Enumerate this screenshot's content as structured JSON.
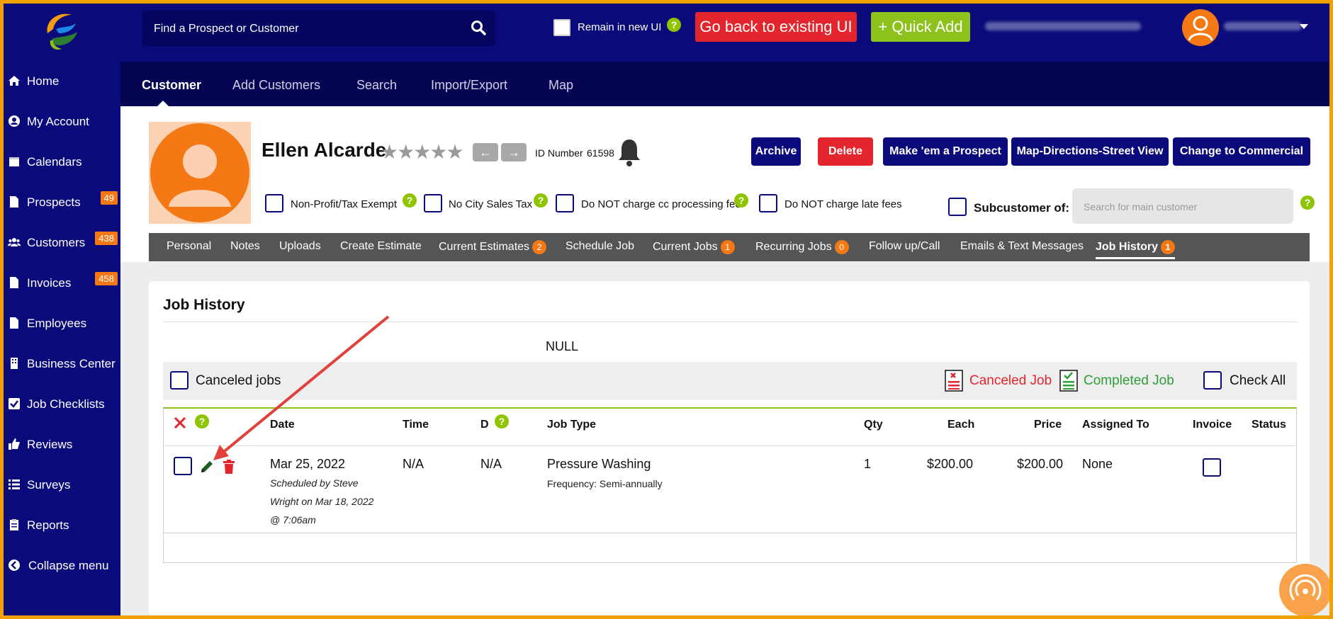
{
  "topbar": {
    "search_placeholder": "Find a Prospect or Customer",
    "remain_label": "Remain in new UI",
    "go_back_label": "Go back to existing UI",
    "quick_add_label": "+ Quick Add"
  },
  "sidebar": {
    "items": [
      {
        "label": "Home",
        "icon": "home-icon"
      },
      {
        "label": "My Account",
        "icon": "user-circle-icon"
      },
      {
        "label": "Calendars",
        "icon": "calendar-icon"
      },
      {
        "label": "Prospects",
        "icon": "file-icon",
        "badge": "49"
      },
      {
        "label": "Customers",
        "icon": "users-icon",
        "badge": "438"
      },
      {
        "label": "Invoices",
        "icon": "file-icon",
        "badge": "458"
      },
      {
        "label": "Employees",
        "icon": "file-icon"
      },
      {
        "label": "Business Center",
        "icon": "building-icon"
      },
      {
        "label": "Job Checklists",
        "icon": "checkbox-icon"
      },
      {
        "label": "Reviews",
        "icon": "thumbs-up-icon"
      },
      {
        "label": "Surveys",
        "icon": "list-icon"
      },
      {
        "label": "Reports",
        "icon": "clipboard-icon"
      },
      {
        "label": "Collapse menu",
        "icon": "chevron-left-circle-icon"
      }
    ]
  },
  "subnav": {
    "items": [
      "Customer",
      "Add Customers",
      "Search",
      "Import/Export",
      "Map"
    ]
  },
  "customer": {
    "name": "Ellen Alcarde",
    "id_label": "ID Number",
    "id_value": "61598",
    "buttons": {
      "archive": "Archive",
      "delete": "Delete",
      "make_prospect": "Make 'em a Prospect",
      "map_directions": "Map-Directions-Street View",
      "change_commercial": "Change to Commercial"
    },
    "checkboxes": {
      "non_profit": "Non-Profit/Tax Exempt",
      "no_city_tax": "No City Sales Tax",
      "no_cc_fee": "Do NOT charge cc processing fee",
      "no_late_fees": "Do NOT charge late fees"
    },
    "subcustomer_label": "Subcustomer of:",
    "subcustomer_placeholder": "Search for main customer"
  },
  "tabs": {
    "personal": "Personal",
    "notes": "Notes",
    "uploads": "Uploads",
    "create_estimate": "Create Estimate",
    "current_estimates": "Current Estimates",
    "current_estimates_badge": "2",
    "schedule_job": "Schedule Job",
    "current_jobs": "Current Jobs",
    "current_jobs_badge": "1",
    "recurring_jobs": "Recurring Jobs",
    "recurring_jobs_badge": "0",
    "follow_up": "Follow up/Call",
    "emails_texts": "Emails & Text Messages",
    "job_history": "Job History",
    "job_history_badge": "1"
  },
  "job_history": {
    "title": "Job History",
    "null_text": "NULL",
    "canceled_jobs_label": "Canceled jobs",
    "legend_canceled": "Canceled Job",
    "legend_completed": "Completed Job",
    "check_all_label": "Check All",
    "columns": {
      "date": "Date",
      "time": "Time",
      "d": "D",
      "job_type": "Job Type",
      "qty": "Qty",
      "each": "Each",
      "price": "Price",
      "assigned_to": "Assigned To",
      "invoice": "Invoice",
      "status": "Status"
    },
    "rows": [
      {
        "date": "Mar 25, 2022",
        "scheduled_by_1": "Scheduled by Steve",
        "scheduled_by_2": "Wright on Mar 18, 2022",
        "scheduled_by_3": "@ 7:06am",
        "time": "N/A",
        "d": "N/A",
        "job_type": "Pressure Washing",
        "frequency": "Frequency: Semi-annually",
        "qty": "1",
        "each": "$200.00",
        "price": "$200.00",
        "assigned_to": "None"
      }
    ]
  },
  "colors": {
    "navy": "#0a0a7a",
    "dark_navy": "#050553",
    "orange": "#f47914",
    "green": "#8cc21b",
    "red": "#e3262e",
    "frame": "#f0a000"
  }
}
